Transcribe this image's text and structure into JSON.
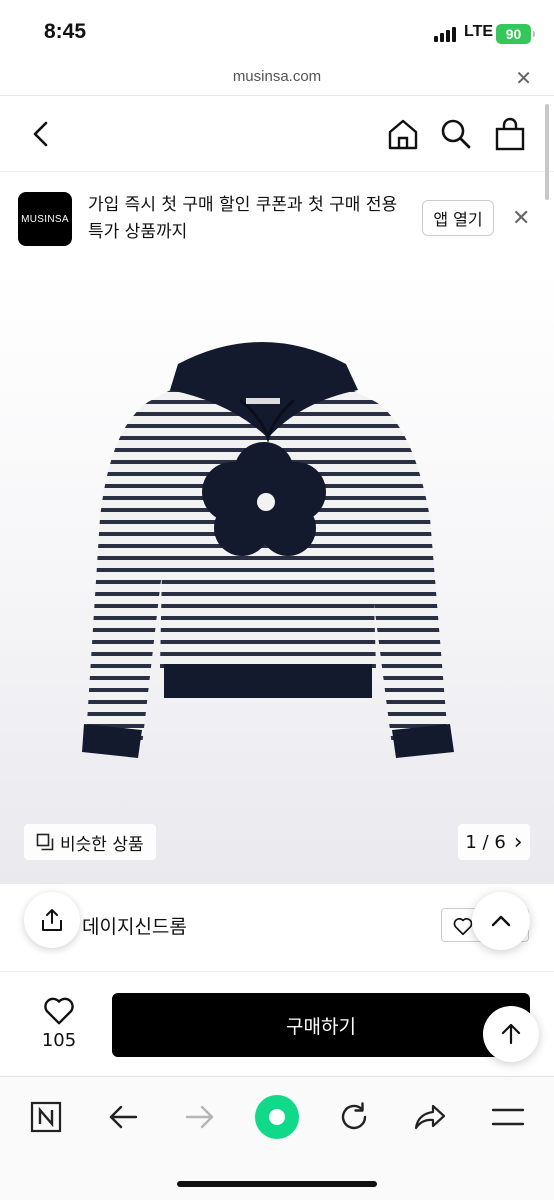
{
  "status": {
    "time": "8:45",
    "network": "LTE",
    "battery": "90"
  },
  "browser": {
    "url": "musinsa.com",
    "close": "✕"
  },
  "banner": {
    "logo_text": "MUSINSA",
    "text": "가입 즉시 첫 구매 할인 쿠폰과 첫 구매 전용 특가 상품까지",
    "open_app": "앱 열기",
    "close": "✕"
  },
  "product": {
    "similar_label": "비슷한 상품",
    "page_indicator": "1 / 6",
    "page_arrow": "›"
  },
  "brand": {
    "name": "데이지신드롬"
  },
  "purchase": {
    "like_count": "105",
    "buy_label": "구매하기"
  },
  "colors": {
    "sweater_navy": "#141a2e",
    "brand_button": "#000000",
    "refresh_accent": "#10d98a"
  }
}
